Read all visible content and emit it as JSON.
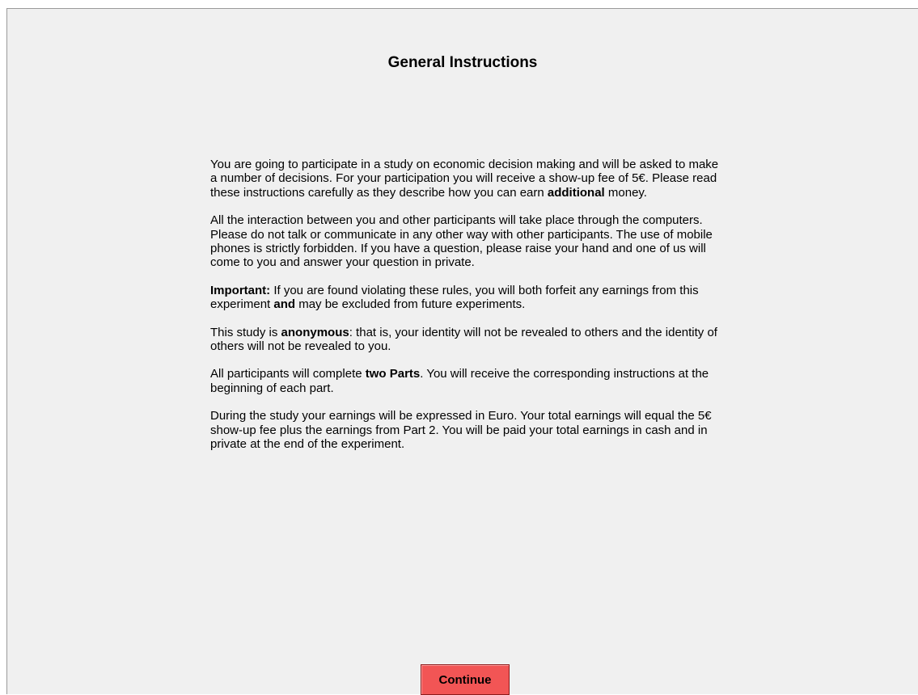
{
  "page": {
    "title": "General Instructions"
  },
  "instructions": {
    "p1": {
      "a": "You are going to participate in a study on economic decision making and will be asked to make a number of decisions. For your participation you will receive a show-up fee of 5€. Please read these instructions carefully as they describe how you can earn ",
      "b": "additional",
      "c": " money."
    },
    "p2": "All the interaction between you and other participants will take place through the computers. Please do not talk or communicate in any other way with other participants. The use of mobile phones is strictly forbidden. If you have a question, please raise your hand and one of us will come to you and answer your question in private.",
    "p3": {
      "a": "Important:",
      "b": " If you are found violating these rules, you will both forfeit any earnings from this experiment ",
      "c": "and",
      "d": " may be excluded from future experiments."
    },
    "p4": {
      "a": "This study is ",
      "b": "anonymous",
      "c": ": that is, your identity will not be revealed to others and the identity of others will not be revealed to you."
    },
    "p5": {
      "a": "All participants will complete ",
      "b": "two Parts",
      "c": ". You will receive the corresponding instructions at the beginning of each part."
    },
    "p6": "During the study your earnings will be expressed in Euro. Your total earnings will equal the 5€ show-up fee plus the earnings from Part 2. You will be paid your total earnings in cash and in private at the end of the experiment."
  },
  "buttons": {
    "continue_label": "Continue"
  },
  "colors": {
    "background": "#f0f0f0",
    "button": "#f25555"
  }
}
